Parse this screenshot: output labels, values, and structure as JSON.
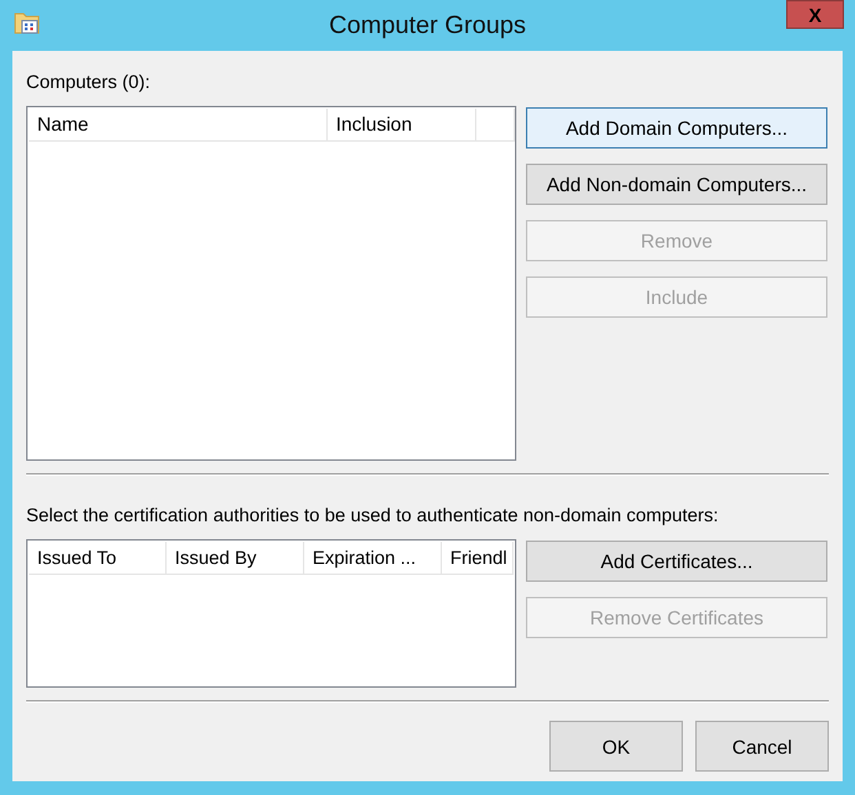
{
  "window": {
    "title": "Computer Groups",
    "close": "X"
  },
  "computers": {
    "label": "Computers (0):",
    "columns": [
      "Name",
      "Inclusion",
      ""
    ],
    "buttons": [
      {
        "label": "Add Domain Computers...",
        "disabled": false,
        "default": true
      },
      {
        "label": "Add Non-domain Computers...",
        "disabled": false,
        "default": false
      },
      {
        "label": "Remove",
        "disabled": true,
        "default": false
      },
      {
        "label": "Include",
        "disabled": true,
        "default": false
      }
    ]
  },
  "certificates": {
    "label": "Select the certification authorities to be used to authenticate non-domain computers:",
    "columns": [
      "Issued To",
      "Issued By",
      "Expiration ...",
      "Friendl"
    ],
    "buttons": [
      {
        "label": "Add Certificates...",
        "disabled": false,
        "default": false
      },
      {
        "label": "Remove Certificates",
        "disabled": true,
        "default": false
      }
    ]
  },
  "footer": {
    "buttons": [
      {
        "label": "OK",
        "disabled": false,
        "default": false
      },
      {
        "label": "Cancel",
        "disabled": false,
        "default": false
      }
    ]
  }
}
